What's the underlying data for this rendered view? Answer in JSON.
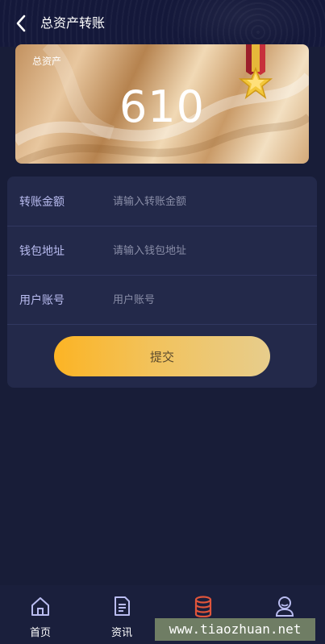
{
  "header": {
    "title": "总资产转账",
    "back_icon": "chevron-left-icon"
  },
  "asset_card": {
    "label": "总资产",
    "value": "610",
    "medal_icon": "medal-star-icon"
  },
  "form": {
    "fields": [
      {
        "label": "转账金额",
        "placeholder": "请输入转账金额",
        "value": ""
      },
      {
        "label": "钱包地址",
        "placeholder": "请输入钱包地址",
        "value": ""
      },
      {
        "label": "用户账号",
        "placeholder": "用户账号",
        "value": ""
      }
    ],
    "submit_label": "提交"
  },
  "tabbar": {
    "items": [
      {
        "label": "首页",
        "icon": "home-icon"
      },
      {
        "label": "资讯",
        "icon": "document-icon"
      },
      {
        "label": "",
        "icon": "coins-icon"
      },
      {
        "label": "",
        "icon": "user-icon"
      }
    ]
  },
  "watermark": "www.tiaozhuan.net",
  "colors": {
    "background": "#181d38",
    "card": "#23294a",
    "accent_start": "#fcb424",
    "accent_end": "#e7cd8c",
    "label": "#b9bcf0",
    "coins_icon": "#e0553b"
  }
}
